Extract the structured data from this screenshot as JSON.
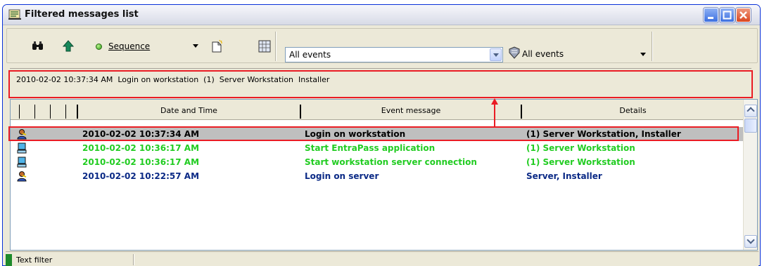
{
  "window": {
    "title": "Filtered messages list"
  },
  "toolbar": {
    "sort_label": "Sequence",
    "event_filter_value": "All events",
    "event_type_label": "All events"
  },
  "filter_text": "2010-02-02 10:37:34 AM  Login on workstation  (1)  Server Workstation  Installer",
  "table": {
    "columns": [
      "Date and Time",
      "Event message",
      "Details"
    ],
    "rows": [
      {
        "icon": "user-key-icon",
        "date": "2010-02-02 10:37:34 AM",
        "event": "Login on workstation",
        "details": "(1)  Server Workstation, Installer",
        "color": "#000000",
        "selected": true
      },
      {
        "icon": "workstation-icon",
        "date": "2010-02-02 10:36:17 AM",
        "event": "Start EntraPass application",
        "details": "(1)  Server Workstation",
        "color": "#22cc22",
        "selected": false
      },
      {
        "icon": "workstation-icon",
        "date": "2010-02-02 10:36:17 AM",
        "event": "Start workstation server connection",
        "details": "(1)  Server Workstation",
        "color": "#22cc22",
        "selected": false
      },
      {
        "icon": "user-key-icon",
        "date": "2010-02-02 10:22:57 AM",
        "event": "Login on server",
        "details": "Server, Installer",
        "color": "#0b2a86",
        "selected": false
      }
    ]
  },
  "status": {
    "text": "Text filter"
  },
  "colors": {
    "highlight_red": "#ea1c24",
    "status_green": "#1d8a2b"
  }
}
